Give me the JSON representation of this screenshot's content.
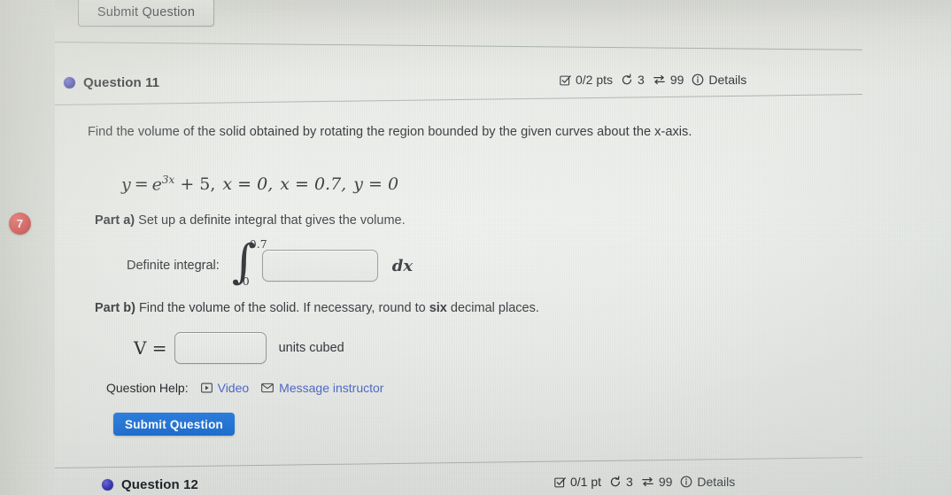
{
  "top_button": {
    "label": "Submit Question"
  },
  "question11": {
    "label": "Question 11",
    "points": "0/2 pts",
    "attempts": "3",
    "versions": "99",
    "details": "Details",
    "prompt": "Find the volume of the solid obtained by rotating the region bounded by the given curves about the x-axis.",
    "equation_plain": "y = e^{3x} + 5, x = 0, x = 0.7, y = 0",
    "equation": {
      "y1": "y",
      "eq1": "=",
      "base": "e",
      "exponent": "3x",
      "plus5": "+ 5,",
      "x_eq_0": "x = 0,",
      "x_eq_07": "x = 0.7,",
      "y_eq_0": "y = 0"
    },
    "margin_badge": "7",
    "part_a": {
      "bold": "Part a)",
      "text": " Set up a definite integral that gives the volume.",
      "integral_label": "Definite integral:",
      "upper_limit": "0.7",
      "lower_limit": "0",
      "integral_glyph": "∫",
      "input_value": "",
      "input_placeholder": "",
      "differential": "dx"
    },
    "part_b": {
      "bold": "Part b)",
      "text_1": " Find the volume of the solid. If necessary, round to ",
      "bold_six": "six",
      "text_2": " decimal places.",
      "v_label": "V =",
      "input_value": "",
      "input_placeholder": "",
      "units": "units cubed"
    },
    "help": {
      "label": "Question Help:",
      "video": "Video",
      "message": "Message instructor"
    },
    "submit": {
      "label": "Submit Question"
    }
  },
  "question12": {
    "label": "Question 12",
    "points": "0/1 pt",
    "attempts": "3",
    "versions": "99",
    "details": "Details"
  },
  "icons": {
    "checkbox": "checkbox-icon",
    "retry": "retry-icon",
    "shuffle": "shuffle-icon",
    "info": "info-icon",
    "video": "video-icon",
    "mail": "mail-icon",
    "bullet": "bullet-dot-icon"
  },
  "colors": {
    "accent_blue": "#2d7fe0",
    "link_blue": "#4a63c8",
    "bullet_indigo": "#3a38b4",
    "badge_red": "#d32a28",
    "page_bg": "#eceeea",
    "text": "#24282c"
  }
}
